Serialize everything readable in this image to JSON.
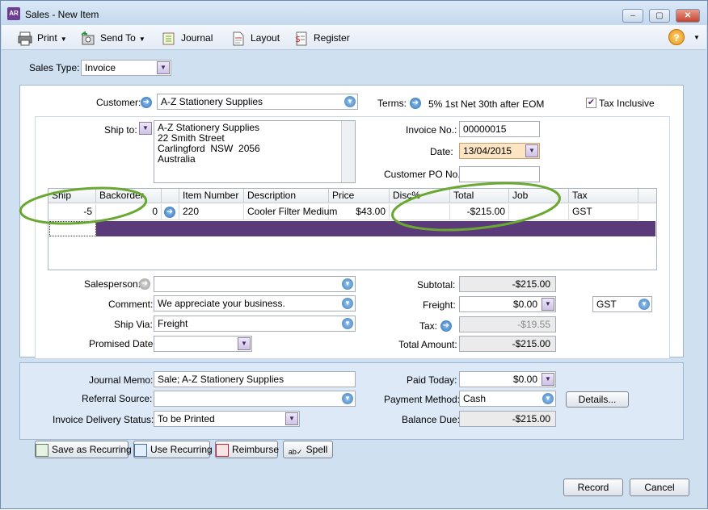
{
  "window": {
    "app_badge": "AR",
    "title": "Sales - New Item",
    "min": "–",
    "max": "▢",
    "close": "✕"
  },
  "toolbar": {
    "print": "Print",
    "send_to": "Send To",
    "journal": "Journal",
    "layout": "Layout",
    "register": "Register",
    "help": "?"
  },
  "sales_type": {
    "label": "Sales Type:",
    "value": "Invoice"
  },
  "customer": {
    "label": "Customer:",
    "value": "A-Z Stationery Supplies"
  },
  "terms": {
    "label": "Terms:",
    "value": "5% 1st Net 30th after EOM"
  },
  "tax_inclusive": {
    "label": "Tax Inclusive",
    "checked": true
  },
  "ship_to": {
    "label": "Ship to:",
    "address": "A-Z Stationery Supplies\n22 Smith Street\nCarlingford  NSW  2056\nAustralia"
  },
  "invoice_no": {
    "label": "Invoice No.:",
    "value": "00000015"
  },
  "date": {
    "label": "Date:",
    "value": "13/04/2015"
  },
  "customer_po": {
    "label": "Customer PO No.:",
    "value": ""
  },
  "grid": {
    "headers": [
      "Ship",
      "Backorder",
      "",
      "Item Number",
      "Description",
      "Price",
      "Disc%",
      "Total",
      "Job",
      "Tax"
    ],
    "rows": [
      {
        "ship": "-5",
        "backorder": "0",
        "item": "220",
        "description": "Cooler Filter Medium",
        "price": "$43.00",
        "disc": "",
        "total": "-$215.00",
        "job": "",
        "tax": "GST"
      }
    ]
  },
  "salesperson": {
    "label": "Salesperson:",
    "value": ""
  },
  "comment": {
    "label": "Comment:",
    "value": "We appreciate your business."
  },
  "ship_via": {
    "label": "Ship Via:",
    "value": "Freight"
  },
  "promised_date": {
    "label": "Promised Date:",
    "value": ""
  },
  "totals": {
    "subtotal_label": "Subtotal:",
    "subtotal": "-$215.00",
    "freight_label": "Freight:",
    "freight": "$0.00",
    "freight_tax": "GST",
    "tax_label": "Tax:",
    "tax": "-$19.55",
    "total_label": "Total Amount:",
    "total": "-$215.00"
  },
  "journal_memo": {
    "label": "Journal Memo:",
    "value": "Sale; A-Z Stationery Supplies"
  },
  "referral_source": {
    "label": "Referral Source:",
    "value": ""
  },
  "delivery_status": {
    "label": "Invoice Delivery Status:",
    "value": "To be Printed"
  },
  "payment": {
    "paid_today_label": "Paid Today:",
    "paid_today": "$0.00",
    "method_label": "Payment Method:",
    "method": "Cash",
    "details": "Details...",
    "balance_label": "Balance Due:",
    "balance": "-$215.00"
  },
  "bottom_buttons": {
    "save_recurring": "Save as Recurring",
    "use_recurring": "Use Recurring",
    "reimburse": "Reimburse",
    "spell": "Spell"
  },
  "actions": {
    "record": "Record",
    "cancel": "Cancel"
  },
  "colors": {
    "annotation": "#6aa832",
    "row_highlight": "#5b3a7a",
    "date_bg": "#fde5c4"
  }
}
